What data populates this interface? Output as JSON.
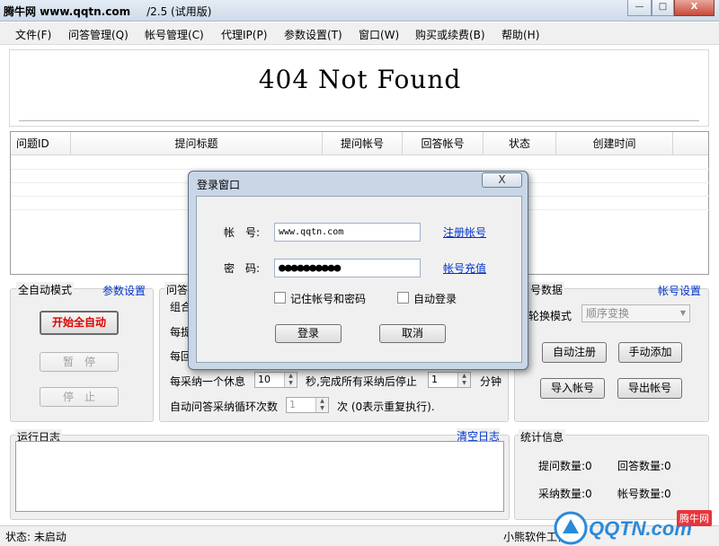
{
  "window": {
    "title_bold": "腾牛网 www.qqtn.com",
    "title_suffix": "/2.5 (试用版)",
    "minimize_symbol": "—",
    "maximize_symbol": "□",
    "close_symbol": "X"
  },
  "menu": [
    "文件(F)",
    "问答管理(Q)",
    "帐号管理(C)",
    "代理IP(P)",
    "参数设置(T)",
    "窗口(W)",
    "购买或续费(B)",
    "帮助(H)"
  ],
  "banner": {
    "text": "404 Not Found"
  },
  "table": {
    "columns": [
      "问题ID",
      "提问标题",
      "提问帐号",
      "回答帐号",
      "状态",
      "创建时间"
    ],
    "rows": []
  },
  "auto_panel": {
    "label": "全自动模式",
    "settings_link": "参数设置",
    "start_button": "开始全自动",
    "pause_button": "暂　停",
    "stop_button": "停　止"
  },
  "qa_panel": {
    "label": "问答",
    "row1_prefix": "组合",
    "row2_prefix": "每提",
    "row3_prefix": "每回",
    "rest_prefix": "每采纳一个休息",
    "rest_value": "10",
    "rest_middle": "秒,完成所有采纳后停止",
    "stop_value": "1",
    "stop_unit": "分钟",
    "loop_prefix": "自动问答采纳循环次数",
    "loop_value": "1",
    "loop_suffix": "次 (0表示重复执行)."
  },
  "account_panel": {
    "label": "号数据",
    "settings_link": "帐号设置",
    "rotate_label": "轮换模式",
    "rotate_value": "顺序变换",
    "auto_register": "自动注册",
    "manual_add": "手动添加",
    "import": "导入帐号",
    "export": "导出帐号"
  },
  "log": {
    "label": "运行日志",
    "clear_link": "清空日志",
    "content": ""
  },
  "stats": {
    "label": "统计信息",
    "questions_label": "提问数量:",
    "questions_value": "0",
    "answers_label": "回答数量:",
    "answers_value": "0",
    "adopted_label": "采纳数量:",
    "adopted_value": "0",
    "accounts_label": "帐号数量:",
    "accounts_value": "0"
  },
  "status": {
    "text": "状态: 未启动",
    "right_text": "小熊软件工作"
  },
  "dialog": {
    "title": "登录窗口",
    "close_symbol": "X",
    "account_label": "帐　号:",
    "account_value": "www.qqtn.com",
    "register_link": "注册帐号",
    "password_label": "密　码:",
    "password_value": "●●●●●●●●●●",
    "recharge_link": "帐号充值",
    "remember_label": "记住帐号和密码",
    "autologin_label": "自动登录",
    "login_button": "登录",
    "cancel_button": "取消"
  },
  "watermark": {
    "text": "QQTN.com",
    "badge": "腾牛网"
  },
  "colors": {
    "link": "#0033cc",
    "start_text": "#e00000",
    "watermark": "#2a8ad8"
  }
}
